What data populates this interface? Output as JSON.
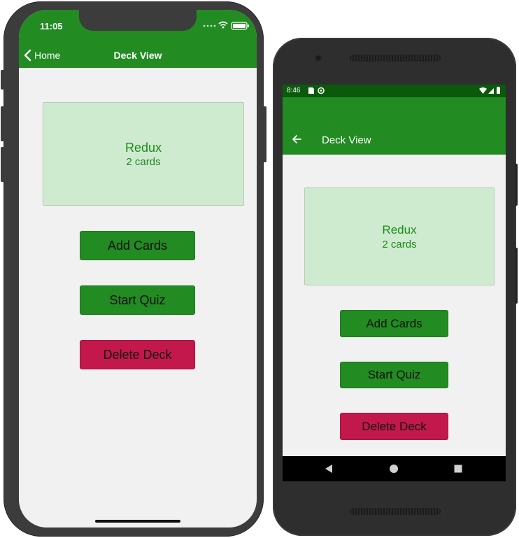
{
  "ios": {
    "time": "11:05",
    "back_label": "Home",
    "title": "Deck View",
    "deck": {
      "title": "Redux",
      "subtitle": "2 cards"
    },
    "buttons": {
      "add": "Add Cards",
      "quiz": "Start Quiz",
      "delete": "Delete Deck"
    }
  },
  "android": {
    "time": "8:46",
    "title": "Deck View",
    "deck": {
      "title": "Redux",
      "subtitle": "2 cards"
    },
    "buttons": {
      "add": "Add Cards",
      "quiz": "Start Quiz",
      "delete": "Delete Deck"
    }
  },
  "colors": {
    "header_green": "#228b22",
    "android_status": "#0b5a0b",
    "card_bg": "#cfebcf",
    "card_text": "#1a8a1a",
    "delete_red": "#c2184b",
    "screen_bg": "#f1f1f1"
  },
  "icons": {
    "ios": [
      "wifi-icon",
      "battery-icon",
      "signal-dots-icon",
      "chevron-left-icon"
    ],
    "android": [
      "arrow-back-icon",
      "sd-card-icon",
      "sync-icon",
      "wifi-icon",
      "signal-icon",
      "battery-icon",
      "nav-back-icon",
      "nav-home-icon",
      "nav-recents-icon"
    ]
  }
}
